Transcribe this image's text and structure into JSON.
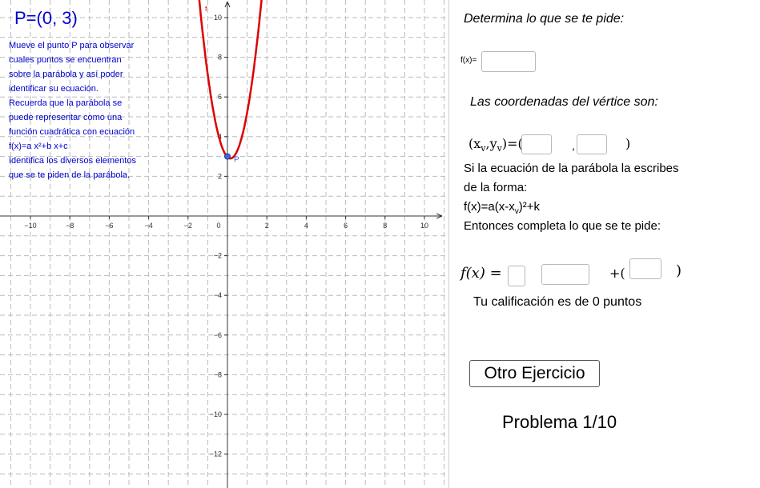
{
  "graph": {
    "point_label": "P=(0, 3)",
    "point_name": "P",
    "function_name": "f",
    "curve_color": "#dd0000",
    "point_color": "#4466dd",
    "instructions": [
      "Mueve el punto P para observar",
      "cuales puntos se encuentran",
      "sobre la parábola y así poder",
      "identificar su ecuación.",
      "Recuerda que la parábola se",
      "puede representar como una",
      "función cuadrática con ecuación",
      "f(x)=a x²+b x+c",
      "Identifica los diversos elementos",
      "que se te piden de la parábola."
    ],
    "x_ticks": [
      "−10",
      "−8",
      "−6",
      "−4",
      "−2",
      "0",
      "2",
      "4",
      "6",
      "8",
      "10"
    ],
    "y_ticks": [
      "10",
      "8",
      "6",
      "4",
      "2",
      "−2",
      "−4",
      "−6",
      "−8",
      "−10",
      "−12"
    ]
  },
  "panel": {
    "heading": "Determina lo que se te pide:",
    "fx_label": "f(x)=",
    "fx_value": "",
    "vertex_heading": "Las coordenadas del vértice son:",
    "vertex_label_main": "(x",
    "vertex_sub_v1": "v",
    "vertex_comma": ",y",
    "vertex_sub_v2": "v",
    "vertex_close_eq": ")=(",
    "vertex_comma_sep": ",",
    "vertex_close": ")",
    "vertex_x_value": "",
    "vertex_y_value": "",
    "vertex_form_line1": "Si la ecuación de la parábola la escribes",
    "vertex_form_line2": "de la forma:",
    "vertex_form_eq_a": "f(x)=a(x-x",
    "vertex_form_eq_sub": "v",
    "vertex_form_eq_b": ")²+k",
    "complete_line": "Entonces completa lo que se te pide:",
    "fx_math": "f(x) =",
    "plus_paren": "+(",
    "close_paren": ")",
    "a_value": "",
    "h_value": "",
    "k_value": "",
    "score": "Tu calificación es de 0 puntos",
    "otro_button": "Otro Ejercicio",
    "problema": "Problema 1/10"
  }
}
